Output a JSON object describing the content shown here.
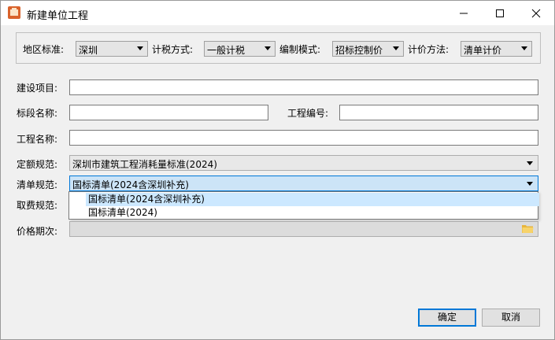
{
  "window": {
    "title": "新建单位工程"
  },
  "top_options": {
    "region_label": "地区标准:",
    "region_value": "深圳",
    "tax_label": "计税方式:",
    "tax_value": "一般计税",
    "mode_label": "编制模式:",
    "mode_value": "招标控制价",
    "pricing_label": "计价方法:",
    "pricing_value": "清单计价"
  },
  "form": {
    "project_label": "建设项目:",
    "project_value": "",
    "section_label": "标段名称:",
    "section_value": "",
    "project_no_label": "工程编号:",
    "project_no_value": "",
    "project_name_label": "工程名称:",
    "project_name_value": "",
    "quota_label": "定额规范:",
    "quota_value": "深圳市建筑工程消耗量标准(2024)",
    "list_label": "清单规范:",
    "list_value": "国标清单(2024含深圳补充)",
    "fee_label": "取费规范:",
    "price_label": "价格期次:",
    "price_value": ""
  },
  "dropdown": {
    "options": [
      "国标清单(2024含深圳补充)",
      "国标清单(2024)"
    ]
  },
  "buttons": {
    "ok": "确定",
    "cancel": "取消"
  }
}
